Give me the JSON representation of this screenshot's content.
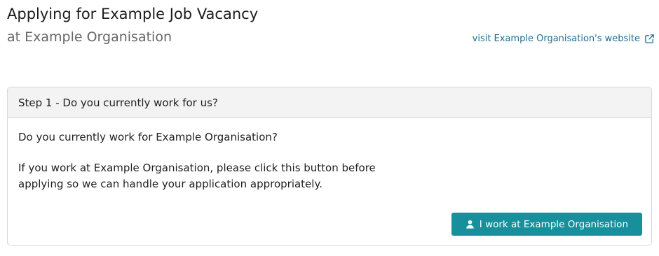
{
  "header": {
    "job_title": "Applying for Example Job Vacancy",
    "org_subtitle": "at Example Organisation",
    "website_link_label": "visit Example Organisation's website",
    "website_link_icon": "external-link-icon"
  },
  "step": {
    "header_label": "Step 1 - Do you currently work for us?",
    "question": "Do you currently work for Example Organisation?",
    "explanation": "If you work at Example Organisation, please click this button before applying so we can handle your application appropriately.",
    "button_label": "I work at Example Organisation",
    "button_icon": "user-icon"
  },
  "colors": {
    "link": "#1f6e92",
    "button": "#17909b",
    "card_header_bg": "#f3f3f3",
    "border": "#d6d6d6"
  }
}
